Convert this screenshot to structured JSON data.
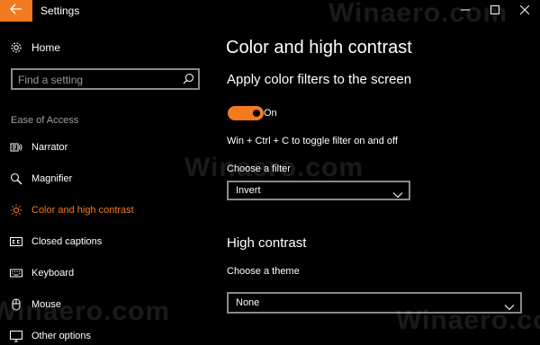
{
  "window": {
    "title": "Settings",
    "accent_color": "#f47a20"
  },
  "sidebar": {
    "home_label": "Home",
    "search": {
      "placeholder": "Find a setting",
      "value": ""
    },
    "section_header": "Ease of Access",
    "items": [
      {
        "label": "Narrator",
        "icon": "narrator-icon",
        "active": false
      },
      {
        "label": "Magnifier",
        "icon": "magnifier-icon",
        "active": false
      },
      {
        "label": "Color and high contrast",
        "icon": "brightness-icon",
        "active": true
      },
      {
        "label": "Closed captions",
        "icon": "closed-captions-icon",
        "active": false
      },
      {
        "label": "Keyboard",
        "icon": "keyboard-icon",
        "active": false
      },
      {
        "label": "Mouse",
        "icon": "mouse-icon",
        "active": false
      },
      {
        "label": "Other options",
        "icon": "other-options-icon",
        "active": false
      }
    ]
  },
  "content": {
    "page_title": "Color and high contrast",
    "color_filters": {
      "heading": "Apply color filters to the screen",
      "toggle_state": "On",
      "hint": "Win + Ctrl + C to toggle filter on and off",
      "filter_label": "Choose a filter",
      "filter_value": "Invert"
    },
    "high_contrast": {
      "heading": "High contrast",
      "theme_label": "Choose a theme",
      "theme_value": "None"
    }
  },
  "watermark": "Winaero.com"
}
